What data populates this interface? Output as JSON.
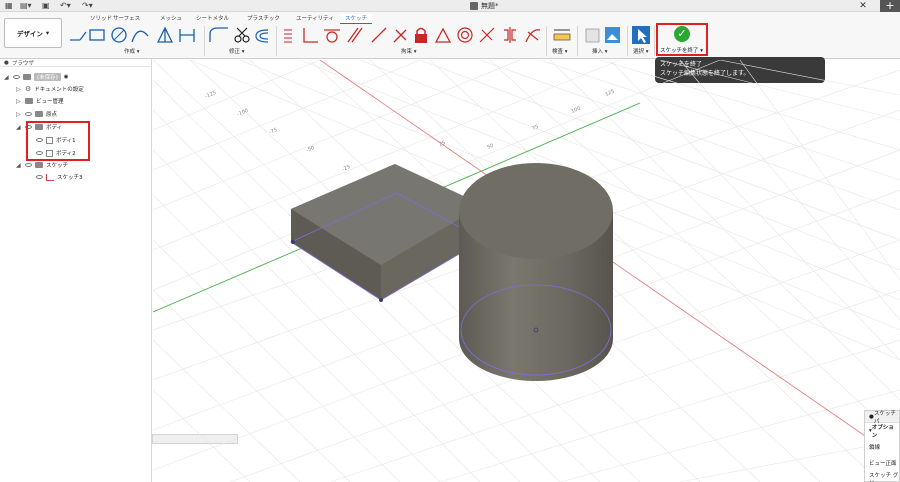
{
  "document_title": "無題*",
  "workspace": {
    "label": "デザイン"
  },
  "ribbon": {
    "tabs": [
      "ソリッド",
      "サーフェス",
      "メッシュ",
      "シートメタル",
      "プラスチック",
      "ユーティリティ",
      "スケッチ"
    ],
    "active_tab": "スケッチ",
    "groups": {
      "create": "作成",
      "modify": "修正",
      "constraints": "拘束",
      "inspect": "検査",
      "insert": "挿入",
      "select": "選択"
    },
    "finish_sketch_label": "スケッチを終了"
  },
  "tooltip": {
    "title": "スケッチを終了",
    "description": "スケッチ編集状態を終了します。"
  },
  "browser": {
    "title": "ブラウザ",
    "root": "(未保存)",
    "items": [
      {
        "label": "ドキュメントの設定"
      },
      {
        "label": "ビュー管理"
      },
      {
        "label": "原点"
      },
      {
        "label": "ボディ"
      },
      {
        "label": "ボディ1"
      },
      {
        "label": "ボディ2"
      },
      {
        "label": "スケッチ"
      },
      {
        "label": "スケッチ3"
      }
    ]
  },
  "right_panel": {
    "title": "スケッチ パ",
    "options": "オプション",
    "rows": [
      "鎖線",
      "ビュー正面",
      "スケッチ グリッ"
    ]
  },
  "grid_ticks": [
    "-125",
    "-100",
    "-75",
    "-50",
    "-25",
    "25",
    "50",
    "75",
    "100",
    "125"
  ],
  "colors": {
    "accent": "#1a73c8",
    "highlight": "#e02020",
    "finish": "#2aa832",
    "body": "#6d6b62",
    "tooltip_bg": "#3a3a3a"
  },
  "icons": [
    "grid-menu-icon",
    "file-icon",
    "save-icon",
    "undo-icon",
    "redo-icon",
    "check-icon",
    "eye-icon",
    "folder-icon",
    "gear-icon",
    "body-icon",
    "sketch-icon"
  ]
}
